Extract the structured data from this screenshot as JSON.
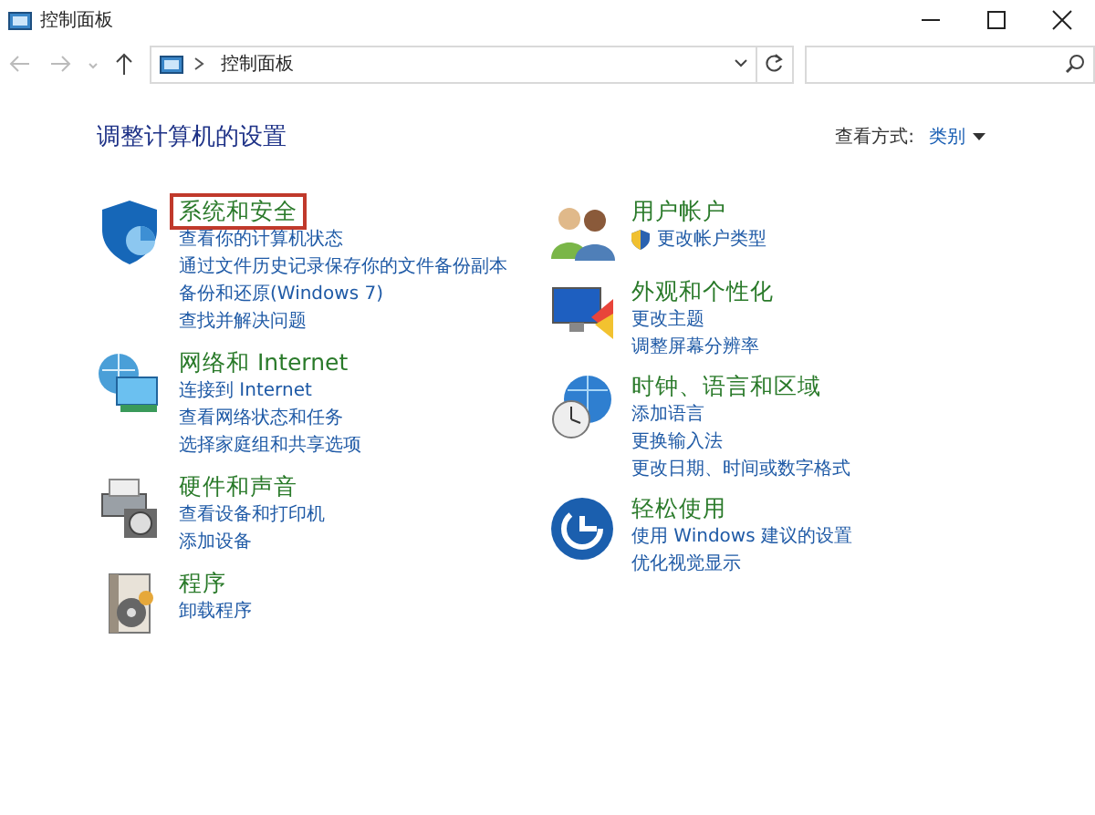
{
  "window": {
    "title": "控制面板"
  },
  "address_bar": {
    "crumb": "控制面板"
  },
  "heading": "调整计算机的设置",
  "view_by": {
    "label": "查看方式:",
    "value": "类别"
  },
  "columns": [
    {
      "categories": [
        {
          "kind": "shield",
          "title": "系统和安全",
          "highlighted": true,
          "links": [
            {
              "text": "查看你的计算机状态"
            },
            {
              "text": "通过文件历史记录保存你的文件备份副本"
            },
            {
              "text": "备份和还原(Windows 7)"
            },
            {
              "text": "查找并解决问题"
            }
          ]
        },
        {
          "kind": "network",
          "title": "网络和 Internet",
          "highlighted": false,
          "links": [
            {
              "text": "连接到 Internet"
            },
            {
              "text": "查看网络状态和任务"
            },
            {
              "text": "选择家庭组和共享选项"
            }
          ]
        },
        {
          "kind": "hardware",
          "title": "硬件和声音",
          "highlighted": false,
          "links": [
            {
              "text": "查看设备和打印机"
            },
            {
              "text": "添加设备"
            }
          ]
        },
        {
          "kind": "programs",
          "title": "程序",
          "highlighted": false,
          "links": [
            {
              "text": "卸载程序"
            }
          ]
        }
      ]
    },
    {
      "categories": [
        {
          "kind": "users",
          "title": "用户帐户",
          "highlighted": false,
          "links": [
            {
              "text": "更改帐户类型",
              "shield": true
            }
          ]
        },
        {
          "kind": "appearance",
          "title": "外观和个性化",
          "highlighted": false,
          "links": [
            {
              "text": "更改主题"
            },
            {
              "text": "调整屏幕分辨率"
            }
          ]
        },
        {
          "kind": "clock",
          "title": "时钟、语言和区域",
          "highlighted": false,
          "links": [
            {
              "text": "添加语言"
            },
            {
              "text": "更换输入法"
            },
            {
              "text": "更改日期、时间或数字格式"
            }
          ]
        },
        {
          "kind": "access",
          "title": "轻松使用",
          "highlighted": false,
          "links": [
            {
              "text": "使用 Windows 建议的设置"
            },
            {
              "text": "优化视觉显示"
            }
          ]
        }
      ]
    }
  ]
}
